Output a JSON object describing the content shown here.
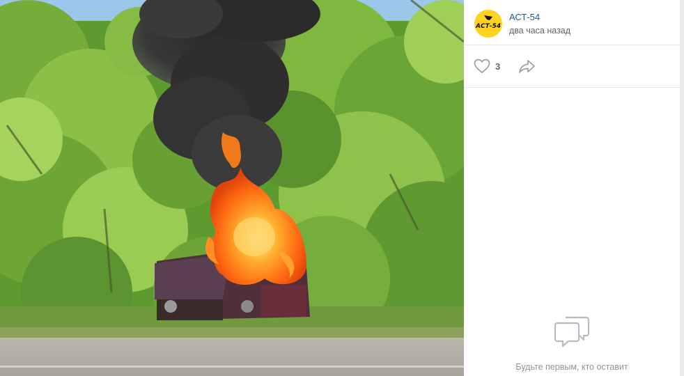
{
  "post": {
    "author": "АСТ-54",
    "avatar_text": "АСТ-54",
    "time": "два часа назад"
  },
  "actions": {
    "likes": "3",
    "like_icon": "heart-icon",
    "share_icon": "share-arrow-icon"
  },
  "comments": {
    "empty_icon": "speech-bubble-icon",
    "empty_text": "Будьте первым, кто оставит"
  },
  "colors": {
    "link": "#2a5885",
    "avatar_bg": "#ffd21f",
    "muted": "#939393"
  }
}
